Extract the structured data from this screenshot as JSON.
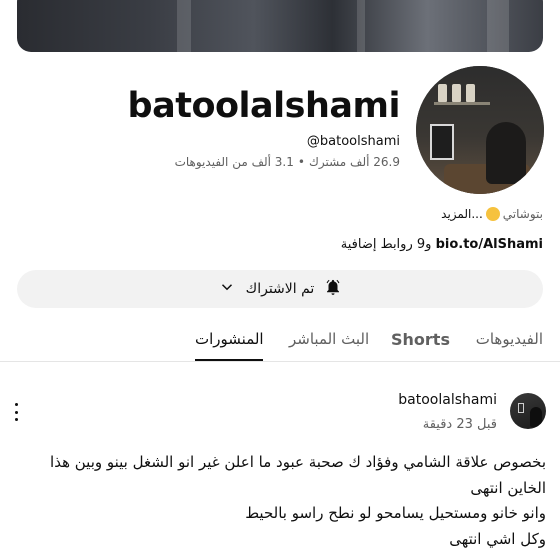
{
  "channel": {
    "name": "batoolalshami",
    "handle": "@batoolshami",
    "subscribers": "26.9 ألف مشترك",
    "videos": "3.1 ألف من الفيديوهات",
    "description": "بتوشاتي",
    "more_label": "...المزيد",
    "link": "bio.to/AlShami",
    "extra_links": "و9 روابط إضافية"
  },
  "subscribe": {
    "label": "تم الاشتراك"
  },
  "tabs": [
    {
      "label": "الفيديوهات"
    },
    {
      "label": "Shorts"
    },
    {
      "label": "البث المباشر"
    },
    {
      "label": "المنشورات"
    }
  ],
  "post": {
    "author": "batoolalshami",
    "time": "قبل 23 دقيقة",
    "lines": [
      "بخصوص علاقة الشامي وفؤاد ك صحبة عبود ما اعلن غير انو الشغل بينو وبين هذا الخاين انتهى",
      "وانو خانو ومستحيل يسامحو لو نطح راسو بالحيط",
      "وكل اشي انتهى"
    ]
  },
  "icons": {
    "bell": "bell-ringing-icon",
    "chevron": "chevron-down-icon",
    "menu": "more-vert-icon"
  }
}
